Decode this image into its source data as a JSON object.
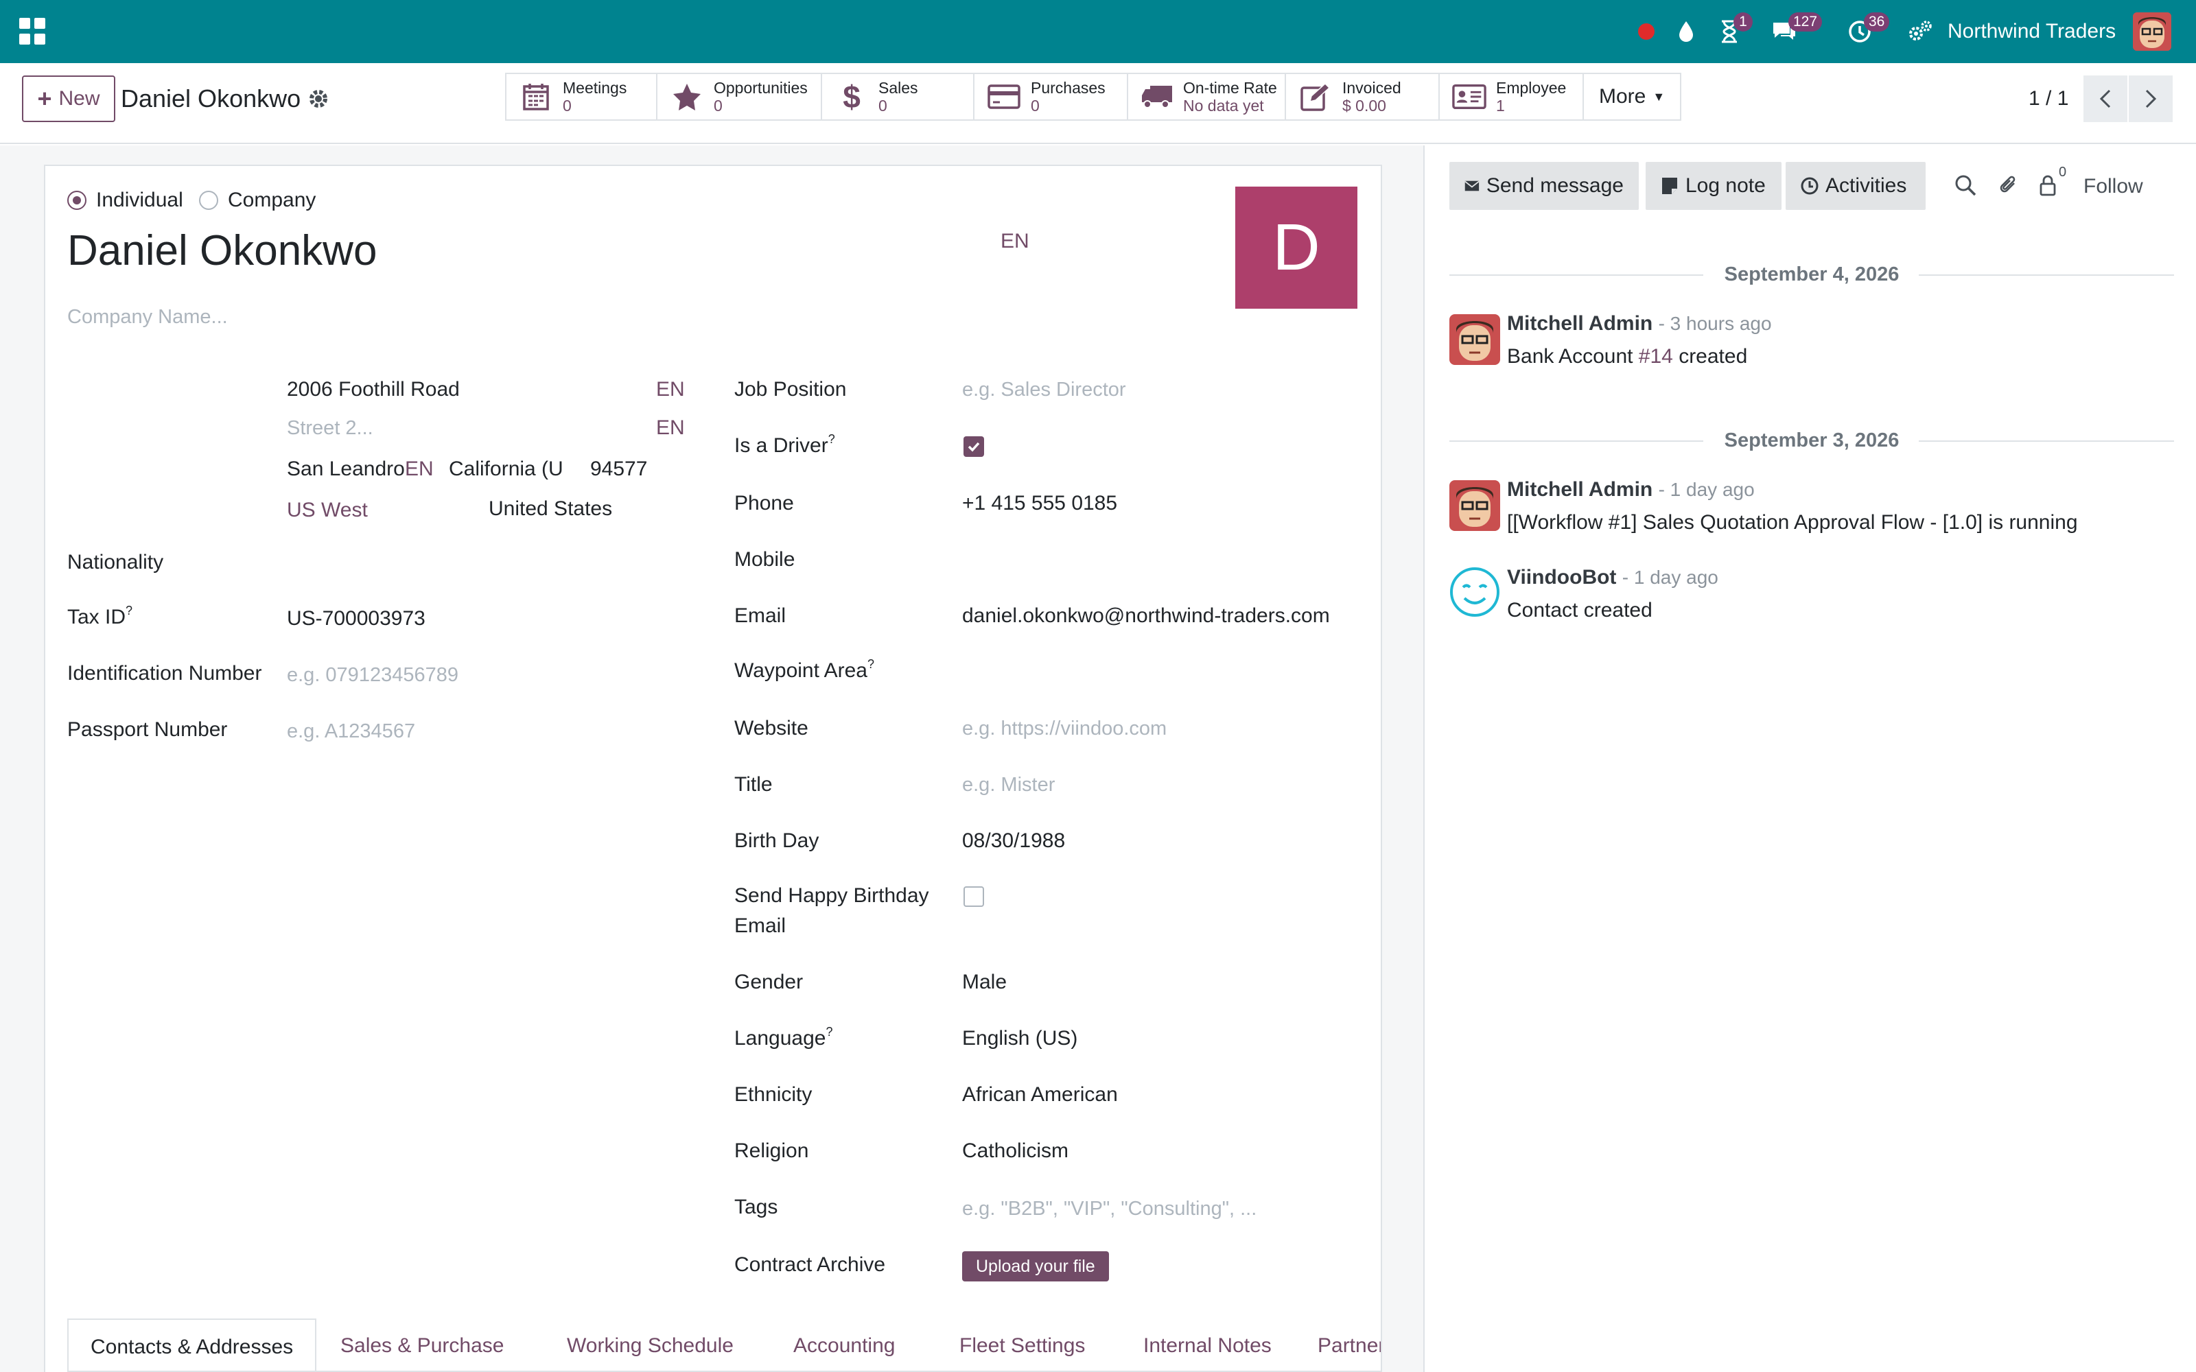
{
  "navbar": {
    "company": "Northwind Traders",
    "badges": {
      "activity": "1",
      "messages": "127",
      "timer": "36"
    },
    "colors": {
      "bar": "#00838f",
      "badge": "#7c3f73",
      "recording": "#e02b2b"
    }
  },
  "control": {
    "new_label": "New",
    "record_name": "Daniel Okonkwo",
    "smart_buttons": [
      {
        "label": "Meetings",
        "value": "0",
        "icon": "calendar-icon"
      },
      {
        "label": "Opportunities",
        "value": "0",
        "icon": "star-icon"
      },
      {
        "label": "Sales",
        "value": "0",
        "icon": "dollar-icon"
      },
      {
        "label": "Purchases",
        "value": "0",
        "icon": "credit-card-icon"
      },
      {
        "label": "On-time Rate",
        "value": "No data yet",
        "icon": "truck-icon"
      },
      {
        "label": "Invoiced",
        "value": "$ 0.00",
        "icon": "pencil-square-icon"
      },
      {
        "label": "Employee",
        "value": "1",
        "icon": "id-card-icon"
      }
    ],
    "more_label": "More",
    "pager": "1 / 1"
  },
  "form": {
    "type_individual": "Individual",
    "type_company": "Company",
    "name": "Daniel Okonkwo",
    "lang_badge": "EN",
    "company_placeholder": "Company Name...",
    "avatar_letter": "D",
    "address": {
      "street": "2006 Foothill Road",
      "street2_placeholder": "Street 2...",
      "city": "San Leandro",
      "state": "California (U",
      "zip": "94577",
      "region": "US West",
      "country": "United States",
      "en": "EN"
    },
    "left_fields": {
      "nationality_label": "Nationality",
      "tax_label": "Tax ID",
      "tax_value": "US-700003973",
      "ident_label": "Identification Number",
      "ident_placeholder": "e.g. 079123456789",
      "passport_label": "Passport Number",
      "passport_placeholder": "e.g. A1234567"
    },
    "right_fields": {
      "job_label": "Job Position",
      "job_placeholder": "e.g. Sales Director",
      "driver_label": "Is a Driver",
      "phone_label": "Phone",
      "phone_value": "+1 415 555 0185",
      "mobile_label": "Mobile",
      "email_label": "Email",
      "email_value": "daniel.okonkwo@northwind-traders.com",
      "waypoint_label": "Waypoint Area",
      "website_label": "Website",
      "website_placeholder": "e.g. https://viindoo.com",
      "title_label": "Title",
      "title_placeholder": "e.g. Mister",
      "birthday_label": "Birth Day",
      "birthday_value": "08/30/1988",
      "happy_label_1": "Send Happy Birthday",
      "happy_label_2": "Email",
      "gender_label": "Gender",
      "gender_value": "Male",
      "language_label": "Language",
      "language_value": "English (US)",
      "ethnicity_label": "Ethnicity",
      "ethnicity_value": "African American",
      "religion_label": "Religion",
      "religion_value": "Catholicism",
      "tags_label": "Tags",
      "tags_placeholder": "e.g. \"B2B\", \"VIP\", \"Consulting\", ...",
      "contract_label": "Contract Archive",
      "upload_label": "Upload your file"
    },
    "tabs": [
      "Contacts & Addresses",
      "Sales & Purchase",
      "Working Schedule",
      "Accounting",
      "Fleet Settings",
      "Internal Notes",
      "Partner Assign"
    ]
  },
  "chatter": {
    "send_message": "Send message",
    "log_note": "Log note",
    "activities": "Activities",
    "followers_count": "0",
    "follow": "Follow",
    "groups": [
      {
        "date": "September 4, 2026",
        "messages": [
          {
            "author": "Mitchell Admin",
            "time": "- 3 hours ago",
            "pre": "Bank Account ",
            "ref": "#14",
            "post": " created"
          }
        ]
      },
      {
        "date": "September 3, 2026",
        "messages": [
          {
            "author": "Mitchell Admin",
            "time": "- 1 day ago",
            "body": "[[Workflow #1] Sales Quotation Approval Flow - [1.0] is running"
          },
          {
            "author": "ViindooBot",
            "time": "- 1 day ago",
            "body": "Contact created"
          }
        ]
      }
    ]
  },
  "colors": {
    "primary": "#714b67",
    "avatar_bg": "#ad3f6b"
  }
}
